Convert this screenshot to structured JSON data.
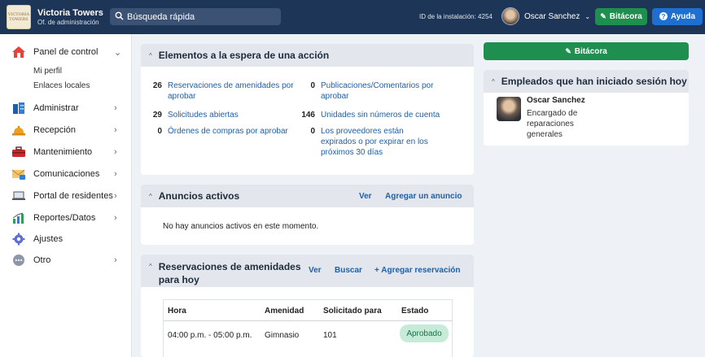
{
  "header": {
    "logo_text": "VICTORIA TOWERS",
    "org_name": "Victoria Towers",
    "org_subtitle": "Of. de administración",
    "search_placeholder": "Búsqueda rápida",
    "install_id": "ID de la instalación: 4254",
    "user_name": "Oscar Sanchez",
    "logbook_label": "Bitácora",
    "help_label": "Ayuda"
  },
  "sidebar": {
    "items": [
      {
        "label": "Panel de control",
        "icon": "home-icon"
      },
      {
        "label": "Administrar",
        "icon": "building-icon"
      },
      {
        "label": "Recepción",
        "icon": "bell-icon"
      },
      {
        "label": "Mantenimiento",
        "icon": "toolbox-icon"
      },
      {
        "label": "Comunicaciones",
        "icon": "mail-icon"
      },
      {
        "label": "Portal de residentes",
        "icon": "laptop-icon"
      },
      {
        "label": "Reportes/Datos",
        "icon": "chart-icon"
      },
      {
        "label": "Ajustes",
        "icon": "gear-icon"
      },
      {
        "label": "Otro",
        "icon": "more-icon"
      }
    ],
    "subitems": [
      "Mi perfil",
      "Enlaces locales"
    ]
  },
  "pending": {
    "title": "Elementos a la espera de una acción",
    "items": [
      {
        "count": "26",
        "label": "Reservaciones de amenidades por aprobar"
      },
      {
        "count": "0",
        "label": "Publicaciones/Comentarios por aprobar"
      },
      {
        "count": "29",
        "label": "Solicitudes abiertas"
      },
      {
        "count": "146",
        "label": "Unidades sin números de cuenta"
      },
      {
        "count": "0",
        "label": "Órdenes de compras por aprobar"
      },
      {
        "count": "0",
        "label": "Los proveedores están expirados o por expirar en los próximos 30 días"
      }
    ]
  },
  "announcements": {
    "title": "Anuncios activos",
    "view_label": "Ver",
    "add_label": "Agregar un anuncio",
    "empty_text": "No hay anuncios activos en este momento."
  },
  "reservations": {
    "title": "Reservaciones de amenidades para hoy",
    "view_label": "Ver",
    "search_label": "Buscar",
    "add_label": "+ Agregar reservación",
    "columns": [
      "Hora",
      "Amenidad",
      "Solicitado para",
      "Estado"
    ],
    "rows": [
      {
        "time": "04:00 p.m. - 05:00 p.m.",
        "amenity": "Gimnasio",
        "requested_for": "101",
        "status": "Aprobado"
      }
    ]
  },
  "right": {
    "logbook_label": "Bitácora",
    "employees_title": "Empleados que han iniciado sesión hoy",
    "employee_name": "Oscar Sanchez",
    "employee_role": "Encargado de reparaciones generales"
  },
  "colors": {
    "topbar": "#1d3557",
    "green": "#1e8f4e",
    "blue": "#1f6fd1",
    "link": "#1f5fa8",
    "highlight": "#cc1f1f"
  }
}
